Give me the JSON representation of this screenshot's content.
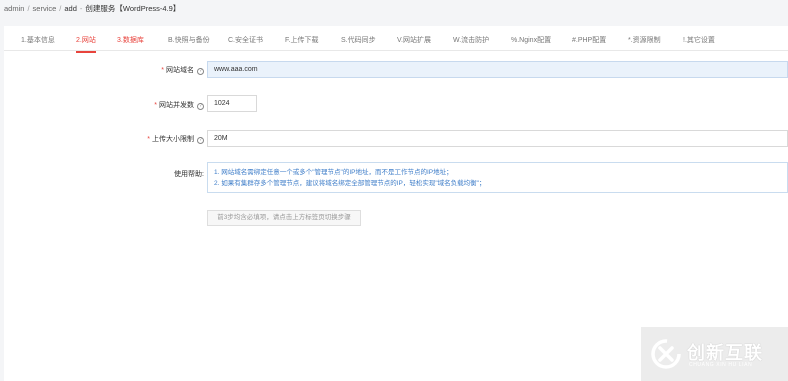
{
  "breadcrumb": {
    "items": [
      "admin",
      "service",
      "add"
    ],
    "separator": "/",
    "dash": "-",
    "current": "创建服务【WordPress-4.9】"
  },
  "tabs": [
    {
      "label": "1.基本信息",
      "state": "normal"
    },
    {
      "label": "2.网站",
      "state": "active"
    },
    {
      "label": "3.数据库",
      "state": "warn"
    },
    {
      "label": "B.快照与备份",
      "state": "normal"
    },
    {
      "label": "C.安全证书",
      "state": "normal"
    },
    {
      "label": "F.上传下载",
      "state": "normal"
    },
    {
      "label": "S.代码同步",
      "state": "normal"
    },
    {
      "label": "V.网站扩展",
      "state": "normal"
    },
    {
      "label": "W.流击防护",
      "state": "normal"
    },
    {
      "label": "%.Nginx配置",
      "state": "normal"
    },
    {
      "label": "#.PHP配置",
      "state": "normal"
    },
    {
      "label": "*.资源限制",
      "state": "normal"
    },
    {
      "label": "!.其它设置",
      "state": "normal"
    }
  ],
  "form": {
    "domain": {
      "label": "网站域名",
      "value": "www.aaa.com",
      "required": true
    },
    "concurrency": {
      "label": "网站并发数",
      "value": "1024",
      "required": true
    },
    "upload_limit": {
      "label": "上传大小限制",
      "value": "20M",
      "required": true
    },
    "help": {
      "label": "使用帮助:",
      "line1": "1. 网站域名需绑定任意一个或多个\"管理节点\"的IP地址，而不是工作节点的IP地址；",
      "line2": "2. 如果有集群存多个管理节点，建议将域名绑定全部管理节点的IP，轻松实现\"域名负载均衡\"；"
    },
    "required_mark": "*",
    "help_icon": "?"
  },
  "hint_button": "前3步均含必填项，请点击上方标签页切换步骤",
  "watermark": {
    "title": "创新互联",
    "subtitle": "CHUANG XIN HU LIAN"
  },
  "colors": {
    "accent": "#e8433c",
    "help_text": "#3f7ec9",
    "focus_bg": "#eaf2fb"
  }
}
